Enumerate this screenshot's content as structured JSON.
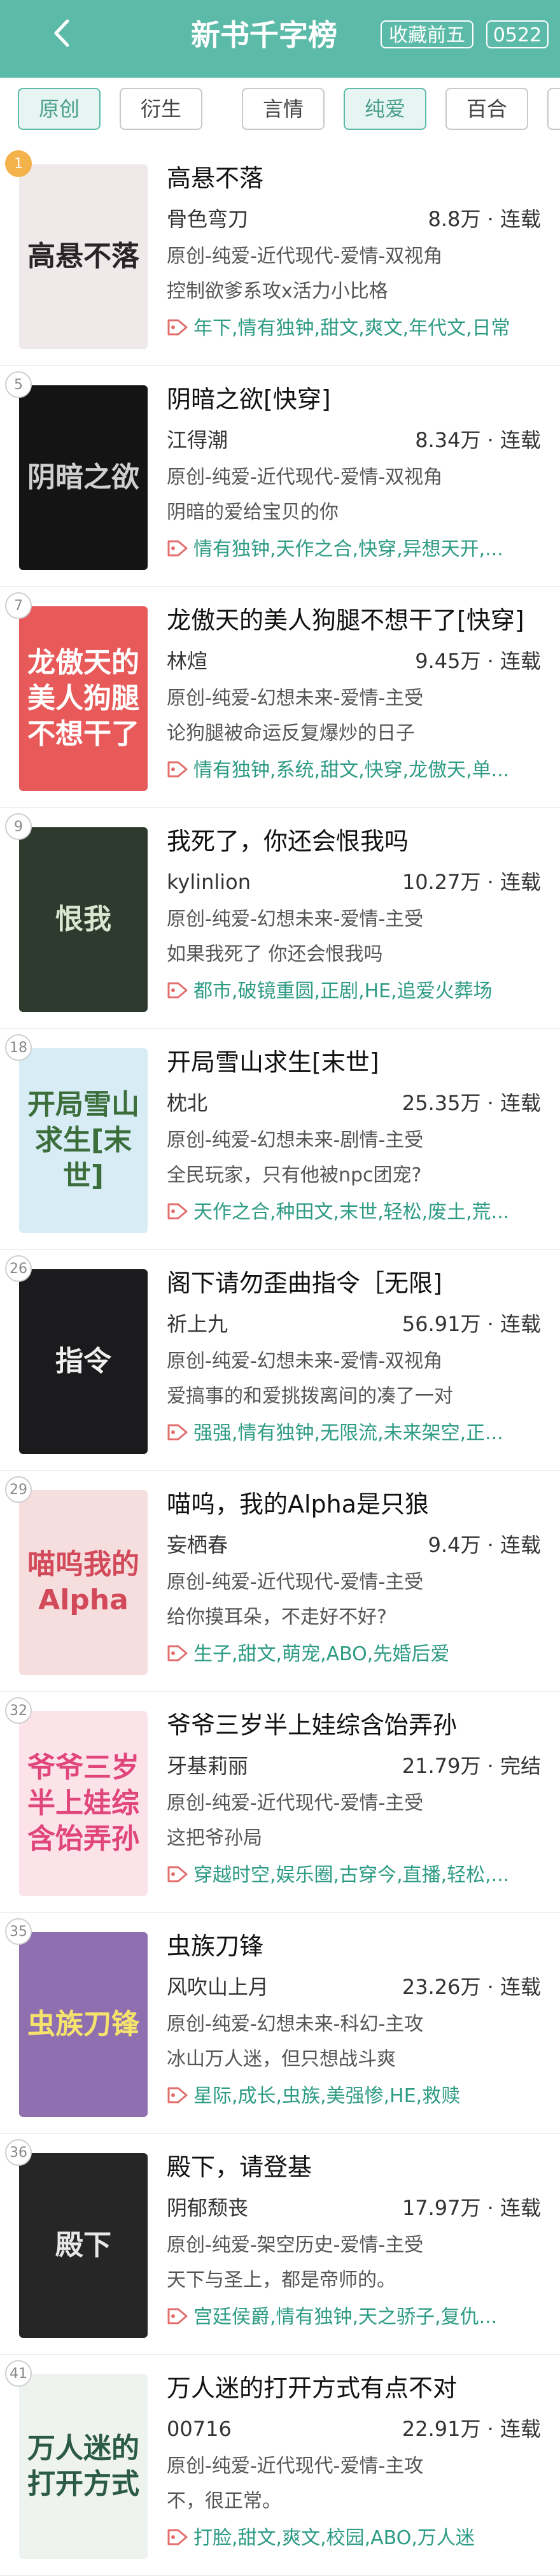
{
  "header": {
    "title": "新书千字榜",
    "btn_top5": "收藏前五",
    "date": "0522"
  },
  "filters": [
    "原创",
    "衍生",
    "言情",
    "纯爱",
    "百合"
  ],
  "books": [
    {
      "rank": "1",
      "cover": "高悬不落",
      "title": "高悬不落",
      "author": "骨色弯刀",
      "words": "8.8万",
      "status": "连载",
      "genre": "原创-纯爱-近代现代-爱情-双视角",
      "desc": "控制欲爹系攻x活力小比格",
      "tags": "年下,情有独钟,甜文,爽文,年代文,日常"
    },
    {
      "rank": "5",
      "cover": "阴暗之欲",
      "title": "阴暗之欲[快穿]",
      "author": "江得潮",
      "words": "8.34万",
      "status": "连载",
      "genre": "原创-纯爱-近代现代-爱情-双视角",
      "desc": "阴暗的爱给宝贝的你",
      "tags": "情有独钟,天作之合,快穿,异想天开,..."
    },
    {
      "rank": "7",
      "cover": "龙傲天的美人狗腿不想干了",
      "title": "龙傲天的美人狗腿不想干了[快穿]",
      "author": "林煊",
      "words": "9.45万",
      "status": "连载",
      "genre": "原创-纯爱-幻想未来-爱情-主受",
      "desc": "论狗腿被命运反复爆炒的日子",
      "tags": "情有独钟,系统,甜文,快穿,龙傲天,单..."
    },
    {
      "rank": "9",
      "cover": "恨我",
      "title": "我死了，你还会恨我吗",
      "author": "kylinlion",
      "words": "10.27万",
      "status": "连载",
      "genre": "原创-纯爱-幻想未来-爱情-主受",
      "desc": "如果我死了 你还会恨我吗",
      "tags": "都市,破镜重圆,正剧,HE,追爱火葬场"
    },
    {
      "rank": "18",
      "cover": "开局雪山求生[末世]",
      "title": "开局雪山求生[末世]",
      "author": "枕北",
      "words": "25.35万",
      "status": "连载",
      "genre": "原创-纯爱-幻想未来-剧情-主受",
      "desc": "全民玩家，只有他被npc团宠?",
      "tags": "天作之合,种田文,末世,轻松,废土,荒..."
    },
    {
      "rank": "26",
      "cover": "指令",
      "title": "阁下请勿歪曲指令［无限]",
      "author": "祈上九",
      "words": "56.91万",
      "status": "连载",
      "genre": "原创-纯爱-幻想未来-爱情-双视角",
      "desc": "爱搞事的和爱挑拨离间的凑了一对",
      "tags": "强强,情有独钟,无限流,未来架空,正..."
    },
    {
      "rank": "29",
      "cover": "喵呜我的Alpha",
      "title": "喵呜，我的Alpha是只狼",
      "author": "妄栖春",
      "words": "9.4万",
      "status": "连载",
      "genre": "原创-纯爱-近代现代-爱情-主受",
      "desc": "给你摸耳朵，不走好不好?",
      "tags": "生子,甜文,萌宠,ABO,先婚后爱"
    },
    {
      "rank": "32",
      "cover": "爷爷三岁半上娃综含饴弄孙",
      "title": "爷爷三岁半上娃综含饴弄孙",
      "author": "牙基莉丽",
      "words": "21.79万",
      "status": "完结",
      "genre": "原创-纯爱-近代现代-爱情-主受",
      "desc": "这把爷孙局",
      "tags": "穿越时空,娱乐圈,古穿今,直播,轻松,..."
    },
    {
      "rank": "35",
      "cover": "虫族刀锋",
      "title": "虫族刀锋",
      "author": "风吹山上月",
      "words": "23.26万",
      "status": "连载",
      "genre": "原创-纯爱-幻想未来-科幻-主攻",
      "desc": "冰山万人迷，但只想战斗爽",
      "tags": "星际,成长,虫族,美强惨,HE,救赎"
    },
    {
      "rank": "36",
      "cover": "殿下",
      "title": "殿下，请登基",
      "author": "阴郁颓丧",
      "words": "17.97万",
      "status": "连载",
      "genre": "原创-纯爱-架空历史-爱情-主受",
      "desc": "天下与圣上，都是帝师的。",
      "tags": "宫廷侯爵,情有独钟,天之骄子,复仇..."
    },
    {
      "rank": "41",
      "cover": "万人迷的打开方式",
      "title": "万人迷的打开方式有点不对",
      "author": "00716",
      "words": "22.91万",
      "status": "连载",
      "genre": "原创-纯爱-近代现代-爱情-主攻",
      "desc": "不，很正常。",
      "tags": "打脸,甜文,爽文,校园,ABO,万人迷"
    }
  ],
  "colors": {
    "accent": "#5cbba8",
    "tag": "#2e9b85"
  }
}
